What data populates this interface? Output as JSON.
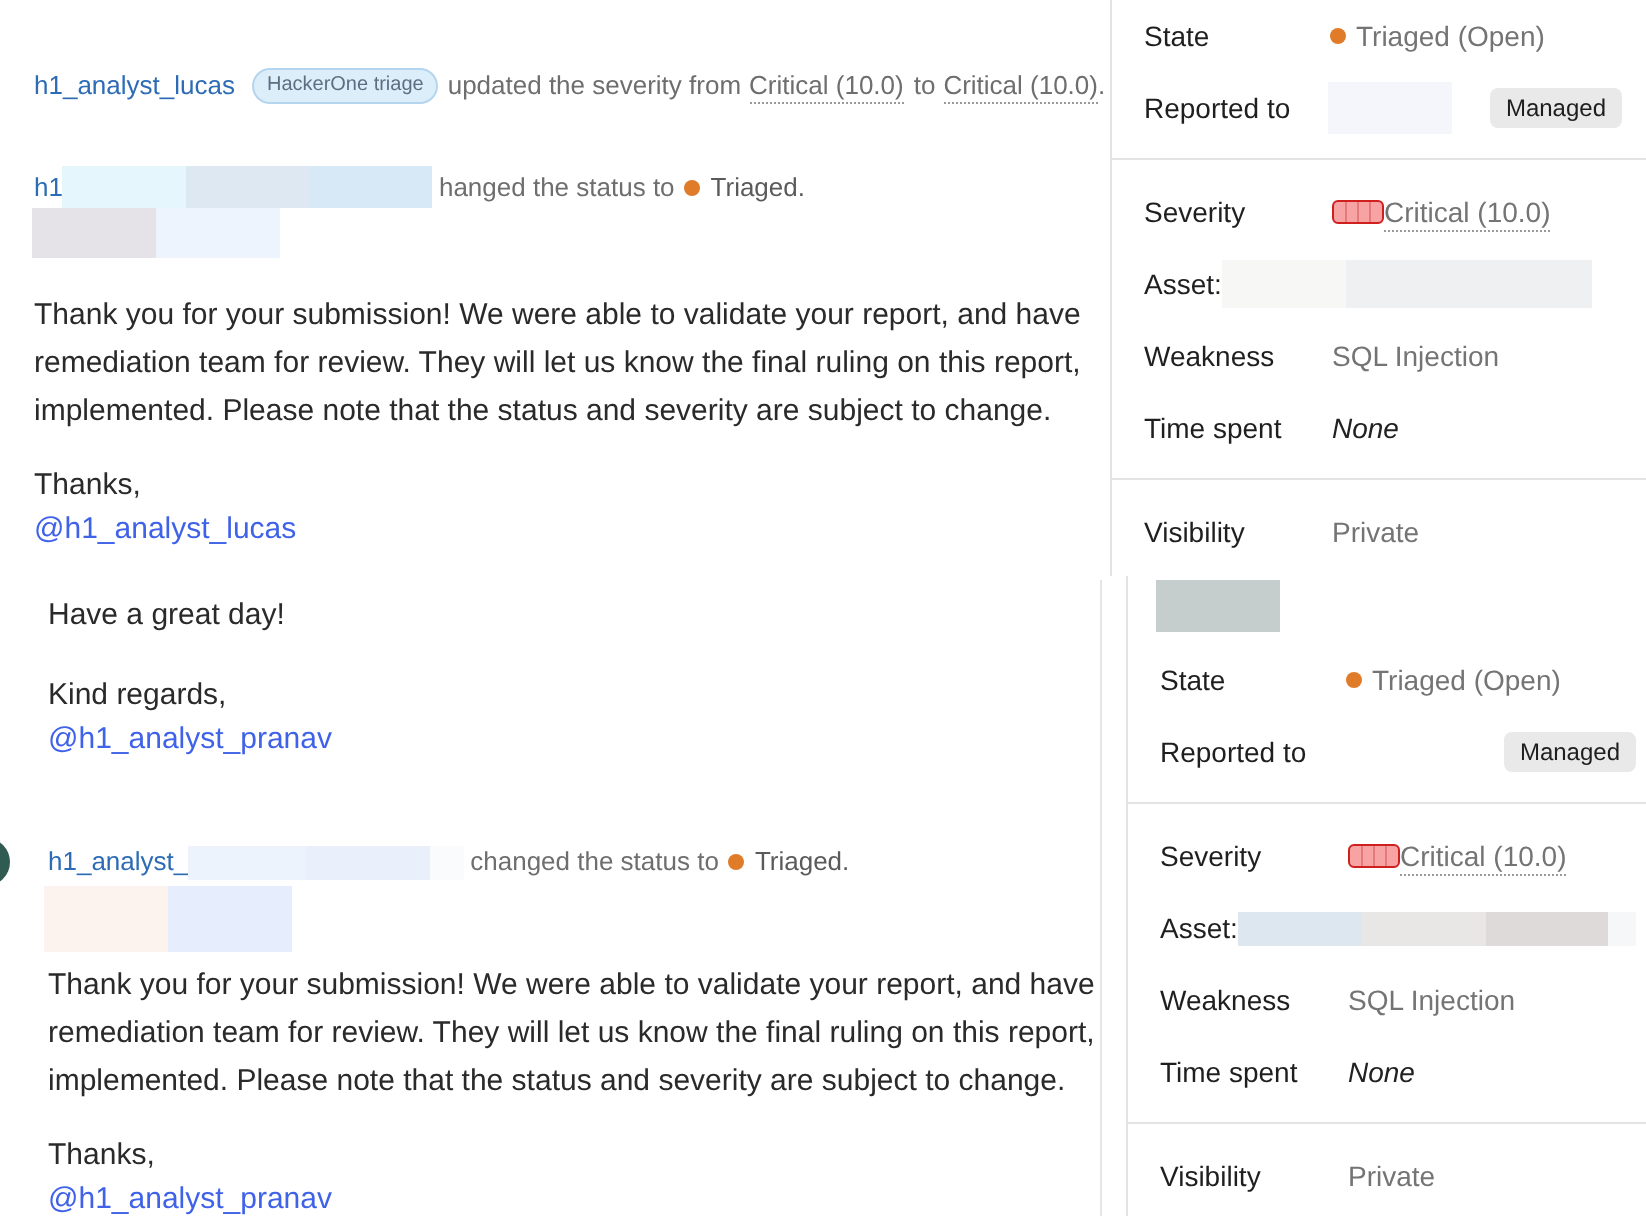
{
  "upper_capture": {
    "feed": [
      {
        "kind": "event",
        "avatar": false,
        "header": [
          {
            "kind": "actor",
            "text": "h1_analyst_lucas"
          },
          {
            "kind": "badge",
            "text": "HackerOne triage"
          },
          {
            "kind": "text",
            "text": "updated the severity from"
          },
          {
            "kind": "severity",
            "text": "Critical (10.0)"
          },
          {
            "kind": "text",
            "text": "to"
          },
          {
            "kind": "severity",
            "text": "Critical (10.0)"
          },
          {
            "kind": "end",
            "text": "."
          }
        ]
      },
      {
        "kind": "event",
        "avatar": false,
        "header": [
          {
            "kind": "actor",
            "text": "h1"
          },
          {
            "kind": "redaction"
          },
          {
            "kind": "text",
            "text": "hanged the status to"
          },
          {
            "kind": "status",
            "text": "Triaged."
          }
        ],
        "body": [
          {
            "kind": "redaction"
          },
          {
            "kind": "paragraph",
            "lines": [
              "Thank you for your submission! We were able to validate your report, and have",
              "remediation team for review. They will let us know the final ruling on this report,",
              "implemented. Please note that the status and severity are subject to change."
            ]
          },
          {
            "kind": "signoff",
            "text": "Thanks,",
            "mention": "@h1_analyst_lucas"
          }
        ]
      }
    ],
    "sidebar": {
      "sections": [
        {
          "rows": [
            {
              "kind": "field",
              "label": "State",
              "items": [
                {
                  "kind": "status",
                  "text": "Triaged (Open)"
                }
              ]
            },
            {
              "kind": "field",
              "label": "Reported to",
              "items": [
                {
                  "kind": "redaction"
                },
                {
                  "kind": "badge",
                  "text": "Managed"
                }
              ]
            }
          ]
        },
        {
          "rows": [
            {
              "kind": "field",
              "label": "Severity",
              "items": [
                {
                  "kind": "severity",
                  "text": "Critical (10.0)"
                }
              ]
            },
            {
              "kind": "inline",
              "label": "Asset:",
              "items": [
                {
                  "kind": "redaction"
                }
              ]
            },
            {
              "kind": "field",
              "label": "Weakness",
              "items": [
                {
                  "kind": "text",
                  "text": "SQL Injection"
                }
              ]
            },
            {
              "kind": "field",
              "label": "Time spent",
              "items": [
                {
                  "kind": "empty",
                  "text": "None"
                }
              ]
            }
          ]
        },
        {
          "rows": [
            {
              "kind": "field",
              "label": "Visibility",
              "items": [
                {
                  "kind": "text",
                  "text": "Private"
                }
              ]
            }
          ]
        }
      ]
    }
  },
  "lower_capture": {
    "feed": [
      {
        "kind": "paragraph",
        "lines": [
          "Have a great day!"
        ]
      },
      {
        "kind": "signoff",
        "text": "Kind regards,",
        "mention": "@h1_analyst_pranav"
      },
      {
        "kind": "event",
        "avatar": true,
        "header": [
          {
            "kind": "actor",
            "text": "h1_analyst_"
          },
          {
            "kind": "redaction"
          },
          {
            "kind": "text",
            "text": "changed the status to"
          },
          {
            "kind": "status",
            "text": "Triaged."
          }
        ],
        "body": [
          {
            "kind": "redaction"
          },
          {
            "kind": "paragraph",
            "lines": [
              "Thank you for your submission! We were able to validate your report, and have",
              "remediation team for review. They will let us know the final ruling on this report,",
              "implemented. Please note that the status and severity are subject to change."
            ]
          },
          {
            "kind": "signoff",
            "text": "Thanks,",
            "mention": "@h1_analyst_pranav"
          }
        ]
      }
    ],
    "sidebar": {
      "sections": [
        {
          "rows": [
            {
              "kind": "redaction"
            },
            {
              "kind": "field",
              "label": "State",
              "items": [
                {
                  "kind": "status",
                  "text": "Triaged (Open)"
                }
              ]
            },
            {
              "kind": "field",
              "label": "Reported to",
              "items": [
                {
                  "kind": "badge",
                  "text": "Managed"
                }
              ]
            }
          ]
        },
        {
          "rows": [
            {
              "kind": "field",
              "label": "Severity",
              "items": [
                {
                  "kind": "severity",
                  "text": "Critical (10.0)"
                }
              ]
            },
            {
              "kind": "inline",
              "label": "Asset:",
              "items": [
                {
                  "kind": "redaction"
                }
              ]
            },
            {
              "kind": "field",
              "label": "Weakness",
              "items": [
                {
                  "kind": "text",
                  "text": "SQL Injection"
                }
              ]
            },
            {
              "kind": "field",
              "label": "Time spent",
              "items": [
                {
                  "kind": "empty",
                  "text": "None"
                }
              ]
            }
          ]
        },
        {
          "rows": [
            {
              "kind": "field",
              "label": "Visibility",
              "items": [
                {
                  "kind": "text",
                  "text": "Private"
                }
              ]
            }
          ]
        }
      ]
    }
  }
}
